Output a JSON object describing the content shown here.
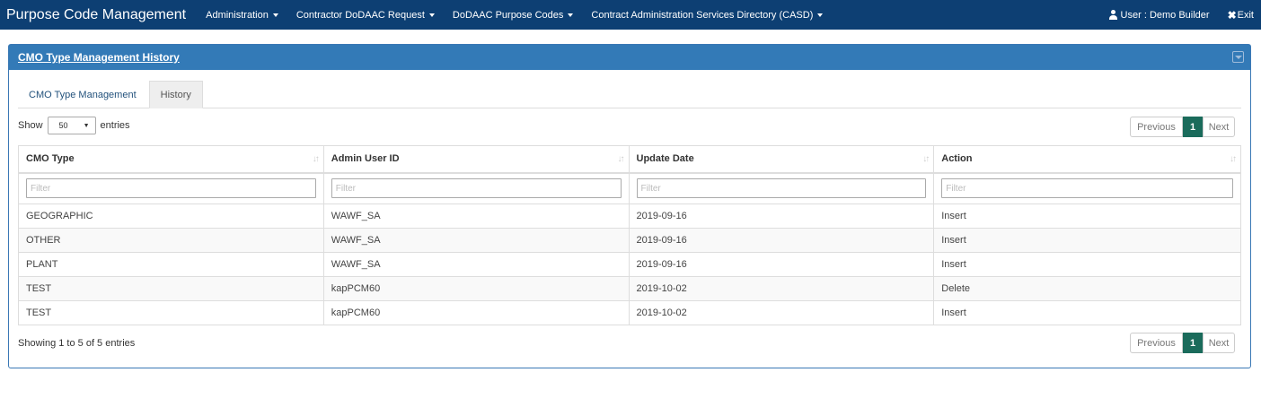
{
  "navbar": {
    "brand": "Purpose Code Management",
    "menus": [
      "Administration",
      "Contractor DoDAAC Request",
      "DoDAAC Purpose Codes",
      "Contract Administration Services Directory (CASD)"
    ],
    "user": "User : Demo Builder",
    "exit": "Exit"
  },
  "panel": {
    "title": "CMO Type Management History",
    "tabs": [
      "CMO Type Management",
      "History"
    ],
    "active_tab": "History"
  },
  "length": {
    "prefix": "Show",
    "value": "50",
    "suffix": "entries"
  },
  "pagination": {
    "previous": "Previous",
    "page": "1",
    "next": "Next"
  },
  "table": {
    "columns": [
      "CMO Type",
      "Admin User ID",
      "Update Date",
      "Action"
    ],
    "filter_placeholder": "Filter",
    "rows": [
      [
        "GEOGRAPHIC",
        "WAWF_SA",
        "2019-09-16",
        "Insert"
      ],
      [
        "OTHER",
        "WAWF_SA",
        "2019-09-16",
        "Insert"
      ],
      [
        "PLANT",
        "WAWF_SA",
        "2019-09-16",
        "Insert"
      ],
      [
        "TEST",
        "kapPCM60",
        "2019-10-02",
        "Delete"
      ],
      [
        "TEST",
        "kapPCM60",
        "2019-10-02",
        "Insert"
      ]
    ]
  },
  "info": "Showing 1 to 5 of 5 entries",
  "colors": {
    "navbar": "#0d3f73",
    "panel_heading": "#337ab7",
    "active_page": "#1a6b5b"
  }
}
